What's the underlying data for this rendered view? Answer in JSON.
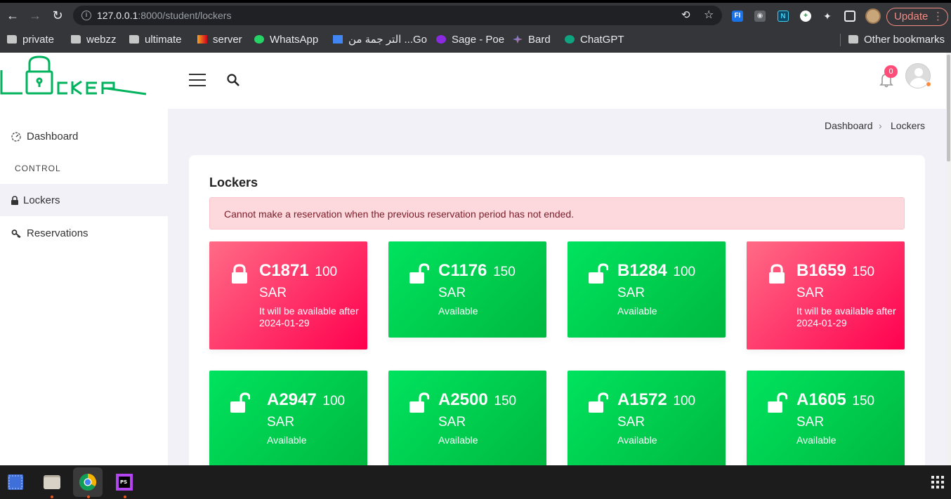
{
  "browser": {
    "url_host": "127.0.0.1",
    "url_rest": ":8000/student/lockers",
    "update_label": "Update",
    "bookmarks": [
      "private",
      "webzz",
      "ultimate",
      "server",
      "WhatsApp",
      "التر جمة من ...Go",
      "Sage - Poe",
      "Bard",
      "ChatGPT"
    ],
    "other_bookmarks": "Other bookmarks"
  },
  "header": {
    "notification_count": "0"
  },
  "sidebar": {
    "dashboard_label": "Dashboard",
    "section_label": "CONTROL",
    "lockers_label": "Lockers",
    "reservations_label": "Reservations"
  },
  "breadcrumb": {
    "root": "Dashboard",
    "current": "Lockers"
  },
  "main": {
    "title": "Lockers",
    "alert": "Cannot make a reservation when the previous reservation period has not ended.",
    "lockers": [
      {
        "code": "C1871",
        "price": "100",
        "currency": "SAR",
        "status": "It will be available after 2024-01-29",
        "state": "reserved"
      },
      {
        "code": "C1176",
        "price": "150",
        "currency": "SAR",
        "status": "Available",
        "state": "available"
      },
      {
        "code": "B1284",
        "price": "100",
        "currency": "SAR",
        "status": "Available",
        "state": "available"
      },
      {
        "code": "B1659",
        "price": "150",
        "currency": "SAR",
        "status": "It will be available after 2024-01-29",
        "state": "reserved"
      },
      {
        "code": "A2947",
        "price": "100",
        "currency": "SAR",
        "status": "Available",
        "state": "available"
      },
      {
        "code": "A2500",
        "price": "150",
        "currency": "SAR",
        "status": "Available",
        "state": "available"
      },
      {
        "code": "A1572",
        "price": "100",
        "currency": "SAR",
        "status": "Available",
        "state": "available"
      },
      {
        "code": "A1605",
        "price": "150",
        "currency": "SAR",
        "status": "Available",
        "state": "available"
      }
    ]
  },
  "colors": {
    "brand": "#00b35c",
    "reserved": "#ff2a5f",
    "available": "#00cc4c",
    "alert_bg": "#fdd9dd"
  }
}
